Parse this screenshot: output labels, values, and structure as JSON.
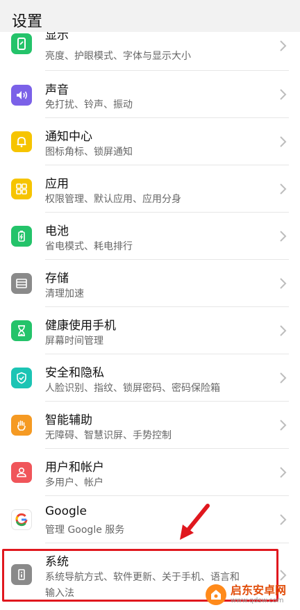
{
  "header": {
    "title": "设置"
  },
  "items": [
    {
      "name": "display",
      "title": "显示",
      "subtitle": "亮度、护眼模式、字体与显示大小",
      "color": "#24c36a",
      "icon": "phone-icon"
    },
    {
      "name": "sound",
      "title": "声音",
      "subtitle": "免打扰、铃声、振动",
      "color": "#7b61e8",
      "icon": "speaker-icon"
    },
    {
      "name": "notification",
      "title": "通知中心",
      "subtitle": "图标角标、锁屏通知",
      "color": "#f6c400",
      "icon": "bell-icon"
    },
    {
      "name": "apps",
      "title": "应用",
      "subtitle": "权限管理、默认应用、应用分身",
      "color": "#f6c400",
      "icon": "grid-icon"
    },
    {
      "name": "battery",
      "title": "电池",
      "subtitle": "省电模式、耗电排行",
      "color": "#24c36a",
      "icon": "battery-icon"
    },
    {
      "name": "storage",
      "title": "存储",
      "subtitle": "清理加速",
      "color": "#8a8a8a",
      "icon": "storage-icon"
    },
    {
      "name": "digital-balance",
      "title": "健康使用手机",
      "subtitle": "屏幕时间管理",
      "color": "#24c36a",
      "icon": "hourglass-icon"
    },
    {
      "name": "security",
      "title": "安全和隐私",
      "subtitle": "人脸识别、指纹、锁屏密码、密码保险箱",
      "color": "#1cc4b4",
      "icon": "shield-icon"
    },
    {
      "name": "accessibility",
      "title": "智能辅助",
      "subtitle": "无障碍、智慧识屏、手势控制",
      "color": "#f59a23",
      "icon": "hand-icon"
    },
    {
      "name": "users",
      "title": "用户和帐户",
      "subtitle": "多用户、帐户",
      "color": "#f0555a",
      "icon": "user-icon"
    },
    {
      "name": "google",
      "title": "Google",
      "subtitle": "管理 Google 服务",
      "color": "#ffffff",
      "icon": "google-icon"
    },
    {
      "name": "system",
      "title": "系统",
      "subtitle": "系统导航方式、软件更新、关于手机、语言和",
      "subtitle2": "输入法",
      "color": "#8a8a8a",
      "icon": "info-icon"
    }
  ],
  "watermark": {
    "name": "启东安卓网",
    "url": "www.qdsw.com"
  },
  "colors": {
    "highlight": "#e0171e"
  }
}
